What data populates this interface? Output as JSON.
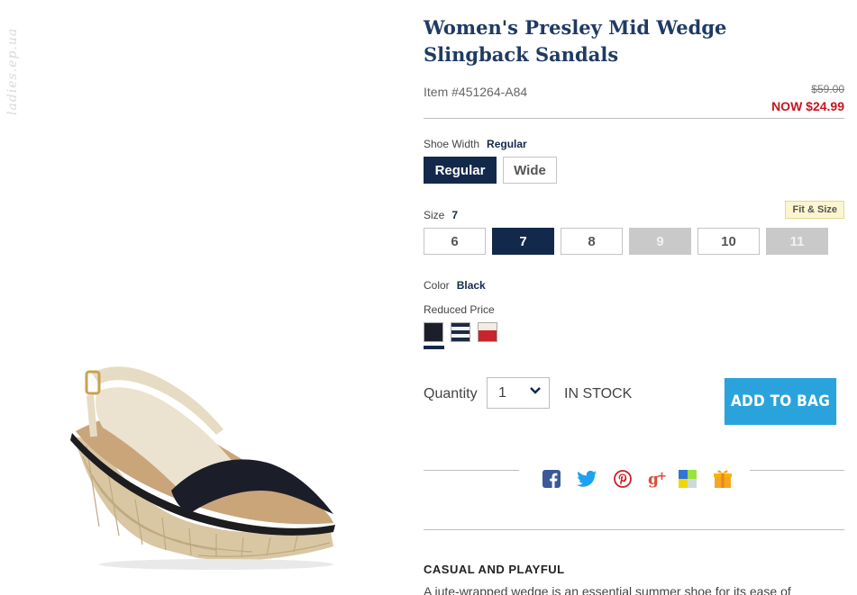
{
  "watermark": "ladies.ep.ua",
  "product": {
    "title": "Women's Presley Mid Wedge Slingback Sandals",
    "item_number": "Item #451264-A84",
    "price_old": "$59.00",
    "price_now": "NOW $24.99"
  },
  "shoe_width": {
    "label": "Shoe Width",
    "selected": "Regular",
    "options": [
      "Regular",
      "Wide"
    ]
  },
  "size": {
    "label": "Size",
    "selected": "7",
    "fit_size_label": "Fit & Size",
    "options": [
      {
        "label": "6",
        "state": "available"
      },
      {
        "label": "7",
        "state": "selected"
      },
      {
        "label": "8",
        "state": "available"
      },
      {
        "label": "9",
        "state": "unavailable"
      },
      {
        "label": "10",
        "state": "available"
      },
      {
        "label": "11",
        "state": "unavailable"
      }
    ]
  },
  "color": {
    "label": "Color",
    "selected": "Black",
    "group_label": "Reduced Price",
    "swatches": [
      "black",
      "navy-white-stripe",
      "red-white"
    ]
  },
  "purchase": {
    "quantity_label": "Quantity",
    "quantity_value": "1",
    "stock_status": "IN STOCK",
    "add_to_bag": "ADD TO BAG"
  },
  "share_icons": [
    "facebook-icon",
    "twitter-icon",
    "pinterest-icon",
    "google-plus-icon",
    "delicious-icon",
    "gift-icon"
  ],
  "description": {
    "heading": "CASUAL AND PLAYFUL",
    "text": "A jute-wrapped wedge is an essential summer shoe for its ease of"
  },
  "colors": {
    "title": "#1f3b63",
    "selected": "#13294b",
    "sale_price": "#c8141e",
    "add_to_bag": "#2aa3dc"
  }
}
